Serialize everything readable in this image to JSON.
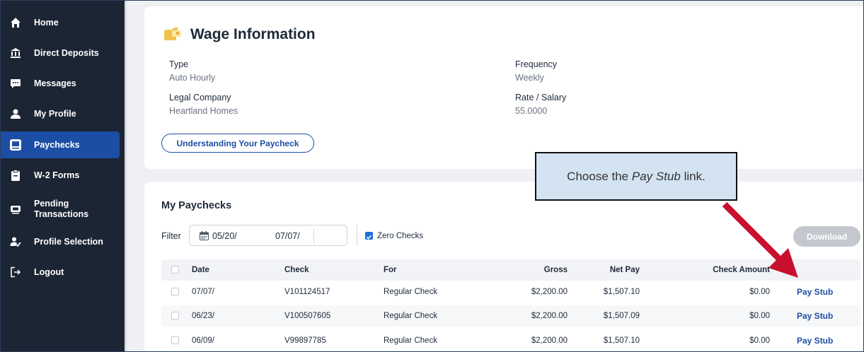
{
  "sidebar": {
    "items": [
      {
        "label": "Home",
        "icon": "home-icon"
      },
      {
        "label": "Direct Deposits",
        "icon": "bank-icon"
      },
      {
        "label": "Messages",
        "icon": "message-icon"
      },
      {
        "label": "My Profile",
        "icon": "user-icon"
      },
      {
        "label": "Paychecks",
        "icon": "paycheck-icon",
        "active": true
      },
      {
        "label": "W-2 Forms",
        "icon": "clipboard-icon"
      },
      {
        "label": "Pending Transactions",
        "icon": "pending-icon"
      },
      {
        "label": "Profile Selection",
        "icon": "profile-select-icon"
      },
      {
        "label": "Logout",
        "icon": "logout-icon"
      }
    ]
  },
  "wage": {
    "title": "Wage Information",
    "type_label": "Type",
    "type_value": "Auto Hourly",
    "company_label": "Legal Company",
    "company_value": "Heartland Homes",
    "frequency_label": "Frequency",
    "frequency_value": "Weekly",
    "rate_label": "Rate / Salary",
    "rate_value": "55.0000",
    "understanding_button": "Understanding Your Paycheck"
  },
  "paychecks": {
    "title": "My Paychecks",
    "filter_label": "Filter",
    "filter_from": "05/20/",
    "filter_to": "07/07/",
    "zero_checks_label": "Zero Checks",
    "zero_checks_checked": true,
    "download_label": "Download",
    "columns": {
      "date": "Date",
      "check": "Check",
      "for": "For",
      "gross": "Gross",
      "net": "Net Pay",
      "amount": "Check Amount"
    },
    "rows": [
      {
        "date": "07/07/",
        "check": "V101124517",
        "for": "Regular Check",
        "gross": "$2,200.00",
        "net": "$1,507.10",
        "amount": "$0.00",
        "link": "Pay Stub"
      },
      {
        "date": "06/23/",
        "check": "V100507605",
        "for": "Regular Check",
        "gross": "$2,200.00",
        "net": "$1,507.09",
        "amount": "$0.00",
        "link": "Pay Stub"
      },
      {
        "date": "06/09/",
        "check": "V99897785",
        "for": "Regular Check",
        "gross": "$2,200.00",
        "net": "$1,507.10",
        "amount": "$0.00",
        "link": "Pay Stub"
      }
    ]
  },
  "callout": {
    "text_before": "Choose the ",
    "text_italic": "Pay Stub",
    "text_after": " link."
  },
  "colors": {
    "sidebar_bg": "#1c2533",
    "active_bg": "#1d4ea6",
    "link": "#1d4ea6",
    "arrow": "#c8102e",
    "callout_bg": "#d3e3f2"
  }
}
